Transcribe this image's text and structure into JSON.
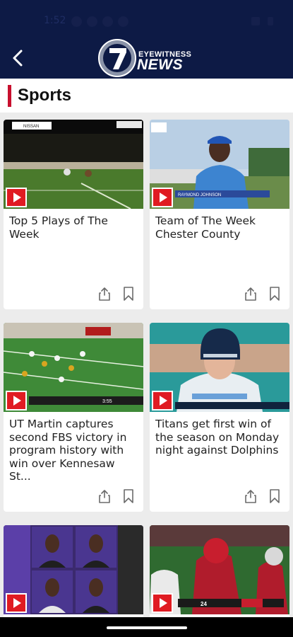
{
  "status_bar": {
    "time": "1:52"
  },
  "header": {
    "back_label": "Back",
    "logo": {
      "number": "7",
      "line1": "EYEWITNESS",
      "line2": "NEWS"
    }
  },
  "section": {
    "title": "Sports",
    "accent_color": "#c8102e"
  },
  "colors": {
    "header_bg": "#0d1a45",
    "play_red": "#e01b22",
    "page_bg": "#ececec"
  },
  "cards": [
    {
      "title": "Top 5 Plays of The Week",
      "thumb_overlay": "NISSAN"
    },
    {
      "title": "Team of The Week Chester County",
      "thumb_overlay": "RAYMOND JOHNSON"
    },
    {
      "title": "UT Martin captures second FBS victory in program history with win over Kennesaw St...",
      "thumb_overlay": "3:55"
    },
    {
      "title": "Titans get first win of the season on Monday night against Dolphins",
      "thumb_overlay": ""
    },
    {
      "title": "",
      "thumb_overlay": ""
    },
    {
      "title": "",
      "thumb_overlay": "24"
    }
  ],
  "icons": {
    "share": "share-icon",
    "bookmark": "bookmark-icon",
    "play": "play-icon"
  }
}
